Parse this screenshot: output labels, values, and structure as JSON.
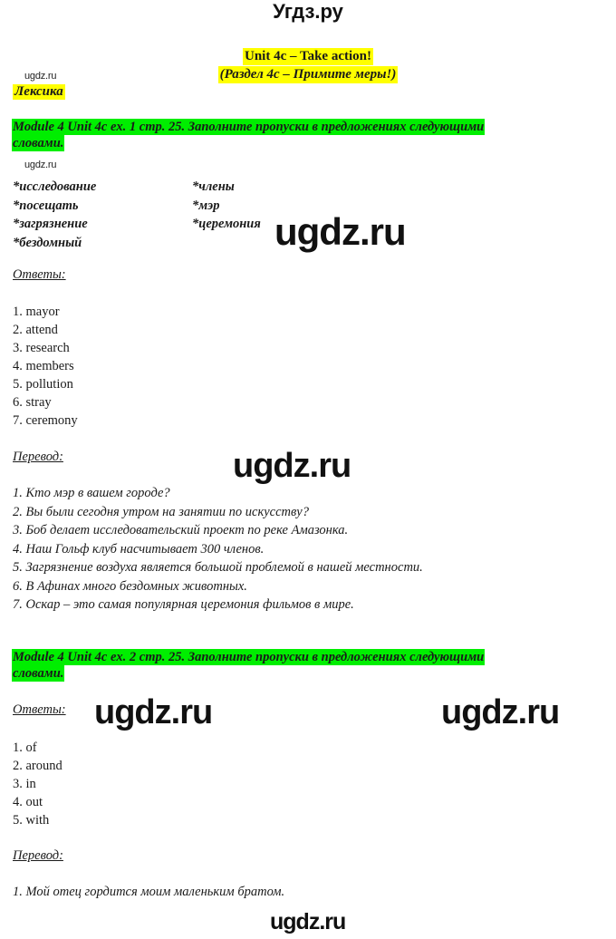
{
  "brand": {
    "header_logo": "Угдз.ру",
    "watermark_text": "ugdz.ru",
    "mini_mark": "ugdz.ru"
  },
  "title": {
    "line_en": "Unit 4c – Take action!",
    "line_ru": "(Раздел 4c – Примите меры!)",
    "highlight_color": "#ffff00"
  },
  "lexika_tag": "Лексика",
  "labels": {
    "answers": "Ответы:",
    "translation": "Перевод:",
    "green_color": "#00ee00"
  },
  "task1": {
    "header_line1": "Module 4 Unit 4c ex. 1 стр. 25. Заполните пропуски в предложениях следующими",
    "header_line2": "словами.",
    "wordbank": [
      {
        "left": "*исследование",
        "right": "*члены"
      },
      {
        "left": "*посещать",
        "right": "*мэр"
      },
      {
        "left": "*загрязнение",
        "right": "*церемония"
      },
      {
        "left": "*бездомный",
        "right": ""
      }
    ],
    "answers": [
      "1. mayor",
      "2. attend",
      "3. research",
      "4. members",
      "5. pollution",
      "6. stray",
      "7. ceremony"
    ],
    "translations": [
      "1. Кто мэр в вашем городе?",
      "2. Вы были сегодня утром на занятии по искусству?",
      "3. Боб делает исследовательский проект по реке Амазонка.",
      "4. Наш Гольф клуб насчитывает 300 членов.",
      "5. Загрязнение воздуха является большой проблемой в нашей местности.",
      "6. В Афинах много бездомных животных.",
      "7. Оскар – это самая популярная церемония фильмов в мире."
    ]
  },
  "task2": {
    "header_line1": "Module 4 Unit 4c ex. 2 стр. 25. Заполните пропуски в предложениях следующими",
    "header_line2": "словами.",
    "answers": [
      "1. of",
      "2. around",
      "3. in",
      "4. out",
      "5. with"
    ],
    "translations": [
      "1. Мой отец гордится моим маленьким братом."
    ]
  }
}
